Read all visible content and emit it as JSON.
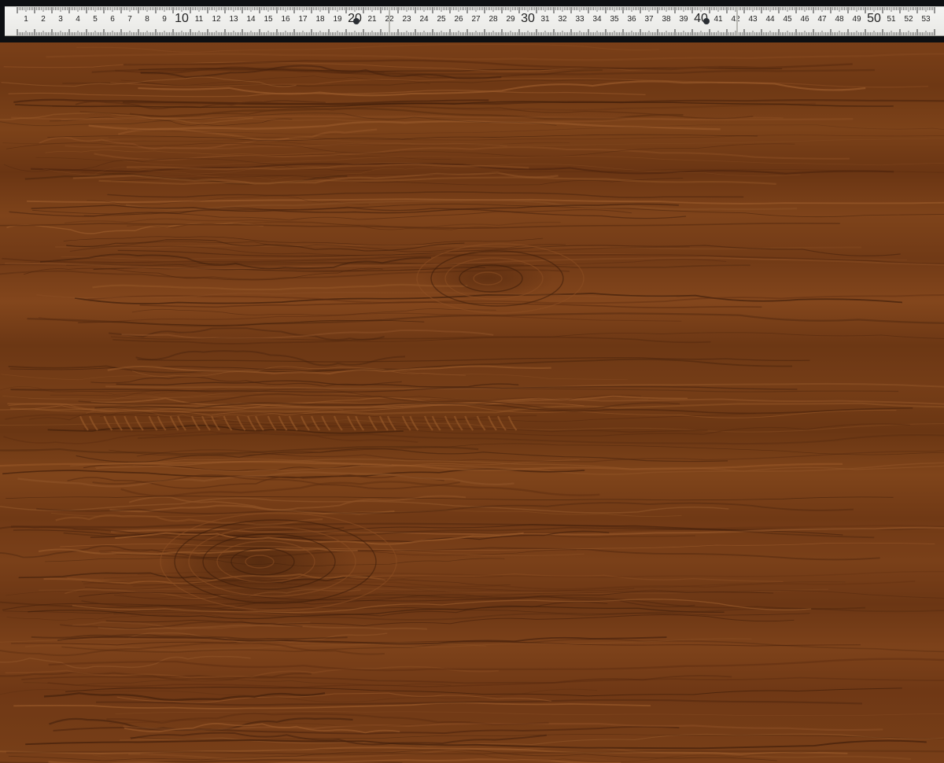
{
  "image": {
    "subject": "Wood grain texture with folding ruler",
    "colors": {
      "wood_base": "#75401a",
      "wood_dark": "#4a2410",
      "wood_light": "#8c4e22",
      "ruler_face": "#f2f2f0",
      "ruler_text": "#222222",
      "background": "#0d0f12"
    }
  },
  "ruler": {
    "numbers": [
      "1",
      "2",
      "3",
      "4",
      "5",
      "6",
      "7",
      "8",
      "9",
      "10",
      "11",
      "12",
      "13",
      "14",
      "15",
      "16",
      "17",
      "18",
      "19",
      "20",
      "21",
      "22",
      "23",
      "24",
      "25",
      "26",
      "27",
      "28",
      "29",
      "30",
      "31",
      "32",
      "33",
      "34",
      "35",
      "36",
      "37",
      "38",
      "39",
      "40",
      "41",
      "42",
      "43",
      "44",
      "45",
      "46",
      "47",
      "48",
      "49",
      "50",
      "51",
      "52",
      "53"
    ],
    "major_numbers": [
      "10",
      "20",
      "30",
      "40",
      "50"
    ]
  }
}
